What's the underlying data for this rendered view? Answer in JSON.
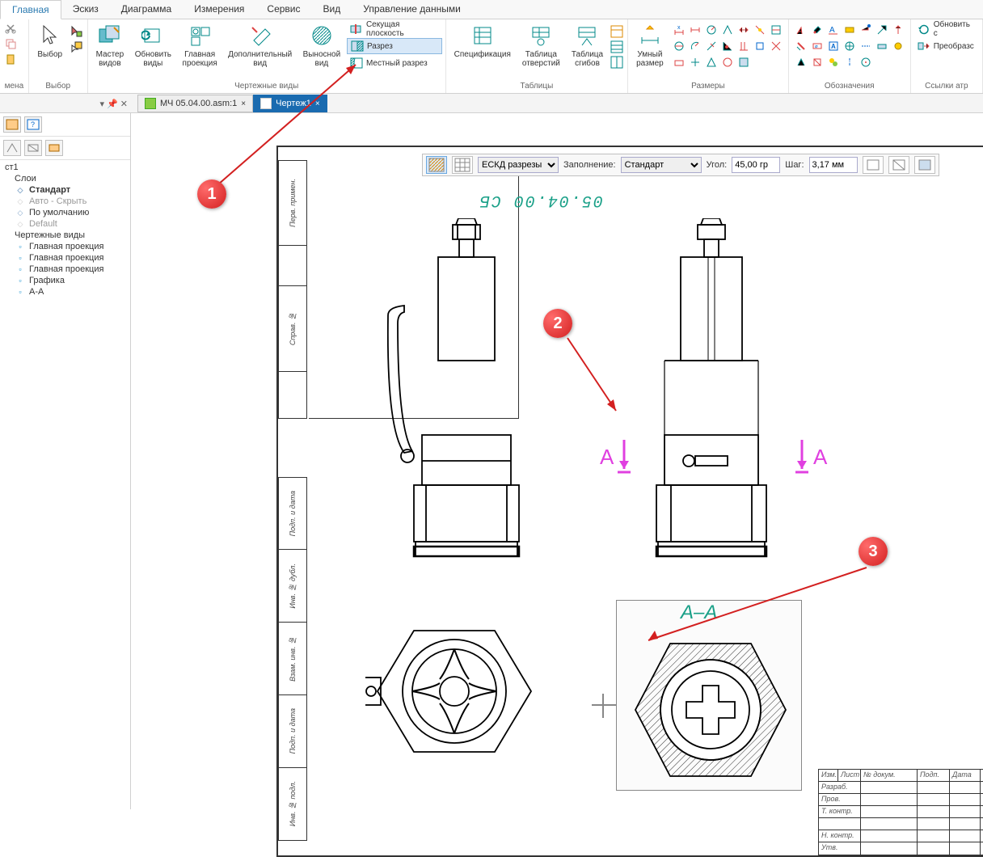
{
  "ribbonTabs": [
    "Главная",
    "Эскиз",
    "Диаграмма",
    "Измерения",
    "Сервис",
    "Вид",
    "Управление данными"
  ],
  "activeTab": "Главная",
  "groups": {
    "rename": {
      "label": "мена"
    },
    "select": {
      "label": "Выбор",
      "btn": "Выбор"
    },
    "views": {
      "label": "Чертежные виды",
      "master": "Мастер\nвидов",
      "update": "Обновить\nвиды",
      "main": "Главная\nпроекция",
      "aux": "Дополнительный\nвид",
      "remote": "Выносной\nвид",
      "cutplane": "Секущая плоскость",
      "section": "Разрез",
      "local": "Местный разрез"
    },
    "tables": {
      "label": "Таблицы",
      "spec": "Спецификация",
      "holes": "Таблица\nотверстий",
      "bends": "Таблица\nсгибов"
    },
    "dims": {
      "label": "Размеры",
      "smart": "Умный\nразмер"
    },
    "annot": {
      "label": "Обозначения"
    },
    "refs": {
      "label": "Ссылки атр",
      "refresh": "Обновить с",
      "convert": "Преобразс"
    }
  },
  "docTabs": [
    {
      "name": "МЧ 05.04.00.asm:1",
      "active": false
    },
    {
      "name": "Чертеж1",
      "active": true
    }
  ],
  "leftPin": {
    "pin": "▾ 📌 ✕"
  },
  "tree": {
    "root": "ст1",
    "layers": "Слои",
    "items": [
      {
        "label": "Стандарт",
        "bold": true
      },
      {
        "label": "Авто - Скрыть",
        "grey": true
      },
      {
        "label": "По умолчанию"
      },
      {
        "label": "Default",
        "grey": true
      }
    ],
    "viewsHeader": "Чертежные виды",
    "views": [
      "Главная проекция",
      "Главная проекция",
      "Главная проекция",
      "Графика",
      "А-А"
    ]
  },
  "canvasToolbar": {
    "style": "ЕСКД разрезы",
    "fillLabel": "Заполнение:",
    "fill": "Стандарт",
    "angleLabel": "Угол:",
    "angle": "45,00 гр",
    "stepLabel": "Шаг:",
    "step": "3,17 мм"
  },
  "drawing": {
    "titleText": "05.04.00 СБ",
    "sectionLetter": "А",
    "sectionTitle": "А–А",
    "sideLabels": [
      "Перв. примен.",
      "Справ. №"
    ],
    "sideLabels2": [
      "Подп. и дата",
      "Инв. № дубл.",
      "Взам. инв. №",
      "Подп. и дата",
      "Инв. № подл."
    ]
  },
  "titleBlock": {
    "headers": [
      "Изм.",
      "Лист",
      "№ докум.",
      "Подп.",
      "Дата"
    ],
    "rows": [
      "Разраб.",
      "Пров.",
      "Т. контр.",
      "",
      "Н. контр.",
      "Утв."
    ]
  },
  "callouts": {
    "c1": "1",
    "c2": "2",
    "c3": "3"
  }
}
